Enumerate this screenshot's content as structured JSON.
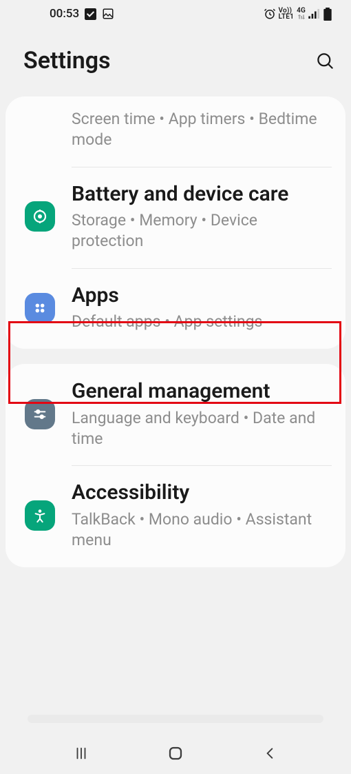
{
  "status": {
    "time": "00:53",
    "network_label_top": "Vo))",
    "network_label_bottom": "LTE1",
    "network_gen": "4G"
  },
  "header": {
    "title": "Settings"
  },
  "group1": {
    "partial": {
      "sub": "Screen time  •  App timers  •  Bedtime mode"
    },
    "battery": {
      "title": "Battery and device care",
      "sub": "Storage  •  Memory  •  Device protection"
    },
    "apps": {
      "title": "Apps",
      "sub": "Default apps  •  App settings"
    }
  },
  "group2": {
    "general": {
      "title": "General management",
      "sub": "Language and keyboard  •  Date and time"
    },
    "accessibility": {
      "title": "Accessibility",
      "sub": "TalkBack  •  Mono audio  •  Assistant menu"
    }
  }
}
